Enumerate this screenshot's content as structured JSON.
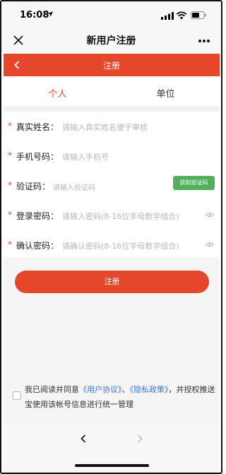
{
  "status_bar": {
    "time": "16:08"
  },
  "nav": {
    "title": "新用户注册"
  },
  "header": {
    "title": "注册"
  },
  "tabs": [
    {
      "label": "个人",
      "active": true
    },
    {
      "label": "单位",
      "active": false
    }
  ],
  "form": {
    "fields": [
      {
        "label": "真实姓名：",
        "placeholder": "请输入真实姓名便于审核",
        "required": true
      },
      {
        "label": "手机号码：",
        "placeholder": "请输入手机号",
        "required": true
      },
      {
        "label": "验证码：",
        "placeholder": "请输入验证码",
        "required": true
      },
      {
        "label": "登录密码：",
        "placeholder": "请输入密码(8-16位字母数字组合)",
        "required": true
      },
      {
        "label": "确认密码：",
        "placeholder": "请确认密码(8-16位字母数字组合)",
        "required": true
      }
    ],
    "required_mark": "*",
    "get_code_label": "获取验证码",
    "submit_label": "注册"
  },
  "agreement": {
    "prefix": "我已阅读并同意",
    "link1": "《用户协议》",
    "sep": "、",
    "link2": "《隐私政策》",
    "suffix": "，并授权推送宝使用该帐号信息进行统一管理",
    "checked": false
  },
  "colors": {
    "accent": "#e4472a",
    "code_button": "#52b05d",
    "link": "#3b77d4"
  },
  "icons": [
    "location-arrow-icon",
    "signal-icon",
    "wifi-icon",
    "battery-icon",
    "close-icon",
    "more-icon",
    "back-icon",
    "eye-icon",
    "forward-icon"
  ]
}
